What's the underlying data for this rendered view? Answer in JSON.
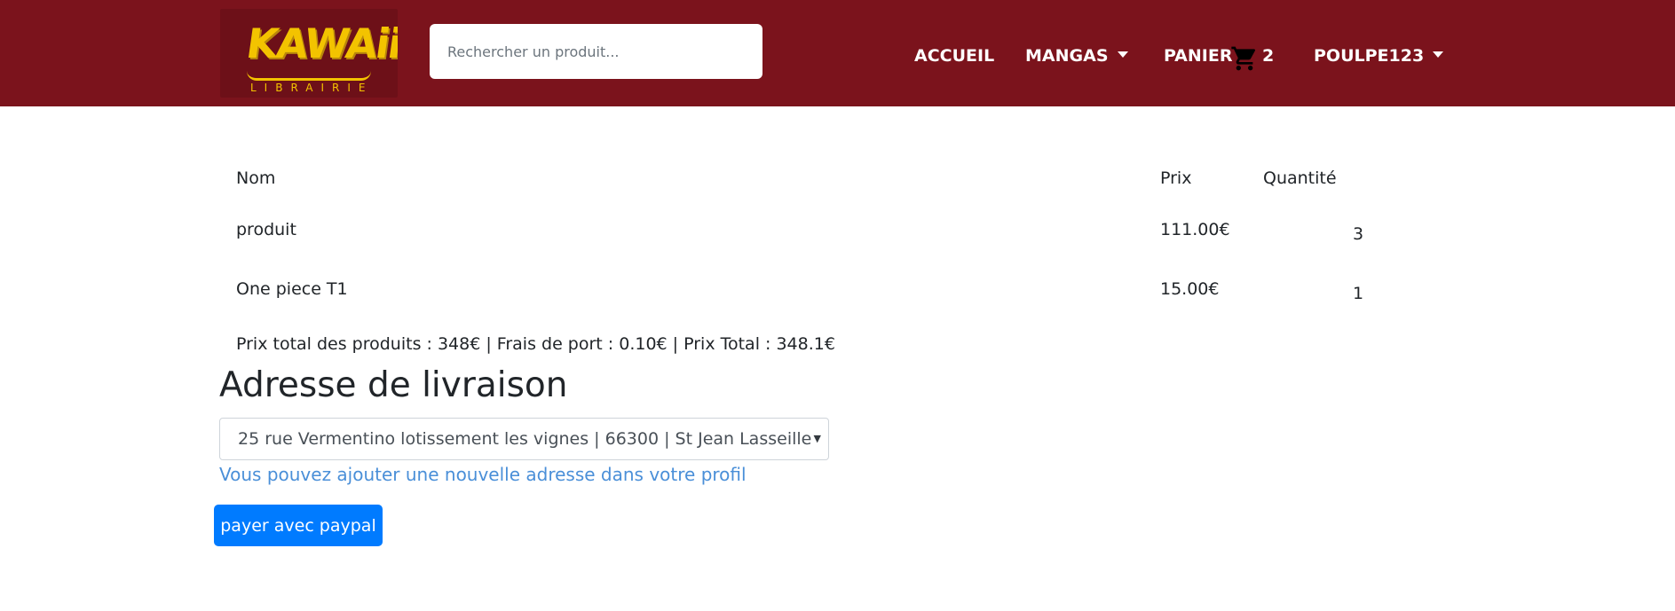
{
  "header": {
    "logo": {
      "title": "KAWAii",
      "subtitle": "LIBRAIRIE"
    },
    "search": {
      "placeholder": "Rechercher un produit...",
      "value": ""
    },
    "nav": {
      "home": "ACCUEIL",
      "mangas": "MANGAS",
      "cart": "PANIER",
      "cart_count": "2",
      "user": "POULPE123"
    }
  },
  "cart": {
    "columns": {
      "name": "Nom",
      "price": "Prix",
      "quantity": "Quantité"
    },
    "rows": [
      {
        "name": "produit",
        "price": "111.00€",
        "quantity": "3"
      },
      {
        "name": "One piece T1",
        "price": "15.00€",
        "quantity": "1"
      }
    ],
    "totals": "Prix total des produits : 348€ | Frais de port : 0.10€ | Prix Total : 348.1€"
  },
  "shipping": {
    "heading": "Adresse de livraison",
    "selected_address": "25 rue Vermentino lotissement les vignes | 66300 | St Jean Lasseille",
    "profile_link": "Vous pouvez ajouter une nouvelle adresse dans votre profil"
  },
  "actions": {
    "pay_label": "payer avec paypal"
  },
  "colors": {
    "navbar": "#7b131c",
    "logo_yellow": "#f3c300",
    "primary": "#007bff",
    "link": "#4a8fd8"
  }
}
